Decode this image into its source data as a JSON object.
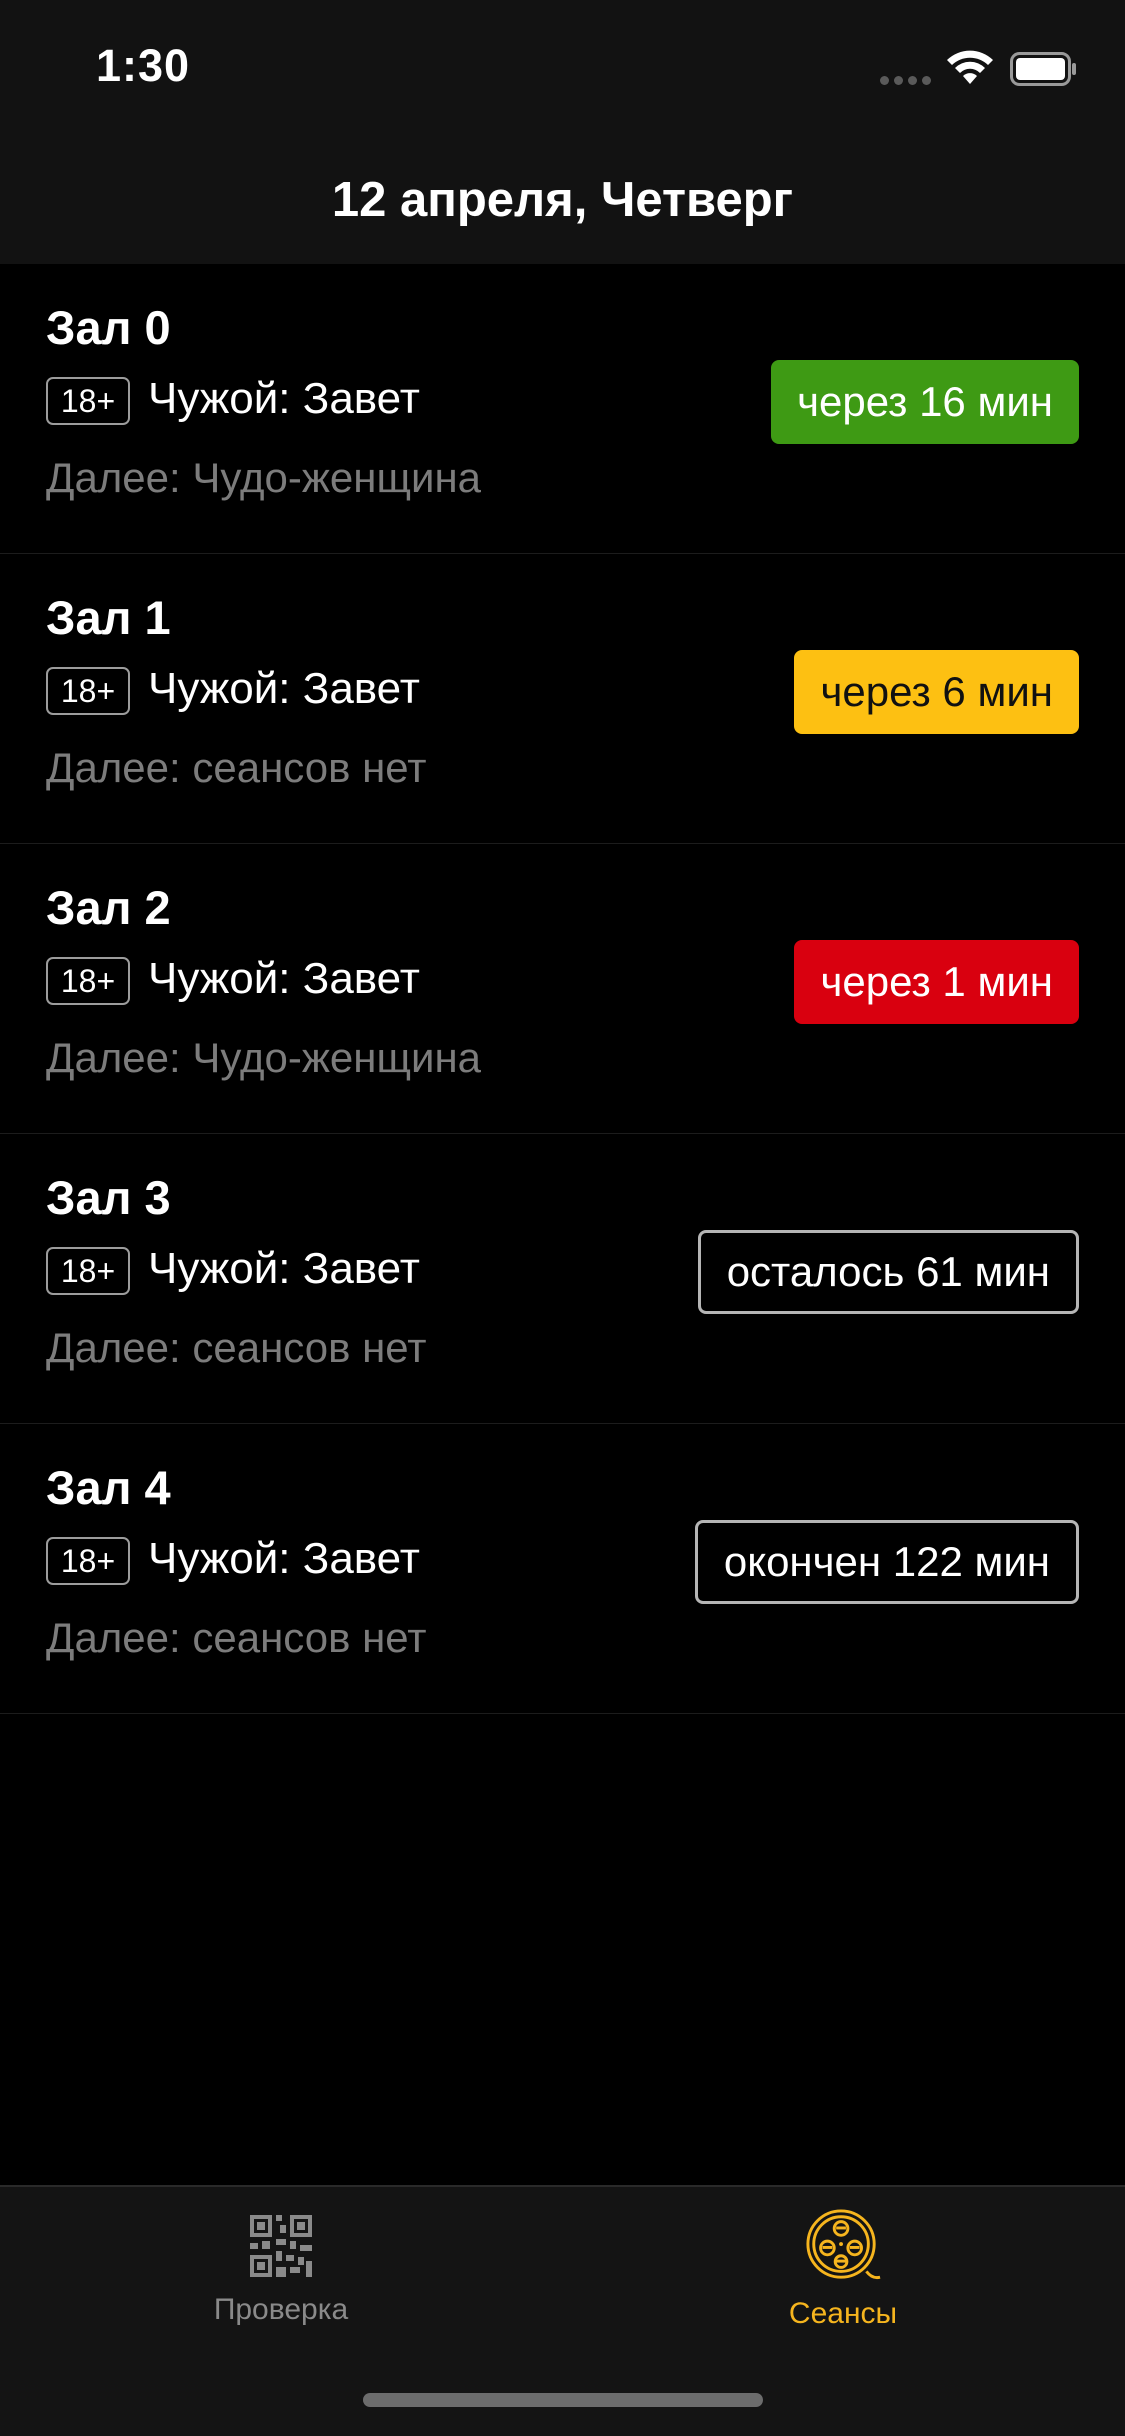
{
  "status_bar": {
    "time": "1:30",
    "signal_icon": "cellular-signal-icon",
    "wifi_icon": "wifi-icon",
    "battery_icon": "battery-icon"
  },
  "nav": {
    "title": "12 апреля, Четверг"
  },
  "halls": [
    {
      "name": "Зал 0",
      "age_rating": "18+",
      "movie": "Чужой: Завет",
      "next": "Далее: Чудо-женщина",
      "status": "через 16 мин",
      "status_style": "green"
    },
    {
      "name": "Зал 1",
      "age_rating": "18+",
      "movie": "Чужой: Завет",
      "next": "Далее: сеансов нет",
      "status": "через 6 мин",
      "status_style": "yellow"
    },
    {
      "name": "Зал 2",
      "age_rating": "18+",
      "movie": "Чужой: Завет",
      "next": "Далее: Чудо-женщина",
      "status": "через 1 мин",
      "status_style": "red"
    },
    {
      "name": "Зал 3",
      "age_rating": "18+",
      "movie": "Чужой: Завет",
      "next": "Далее: сеансов нет",
      "status": "осталось 61 мин",
      "status_style": "outline"
    },
    {
      "name": "Зал 4",
      "age_rating": "18+",
      "movie": "Чужой: Завет",
      "next": "Далее: сеансов нет",
      "status": "окончен 122 мин",
      "status_style": "outline"
    }
  ],
  "tabs": [
    {
      "label": "Проверка",
      "icon": "qr-code-icon",
      "active": false
    },
    {
      "label": "Сеансы",
      "icon": "film-reel-icon",
      "active": true
    }
  ],
  "colors": {
    "accent": "#f6b51e",
    "green": "#3e9a14",
    "yellow": "#fdc012",
    "red": "#d9000f",
    "background": "#000000",
    "bar_background": "#121212"
  }
}
